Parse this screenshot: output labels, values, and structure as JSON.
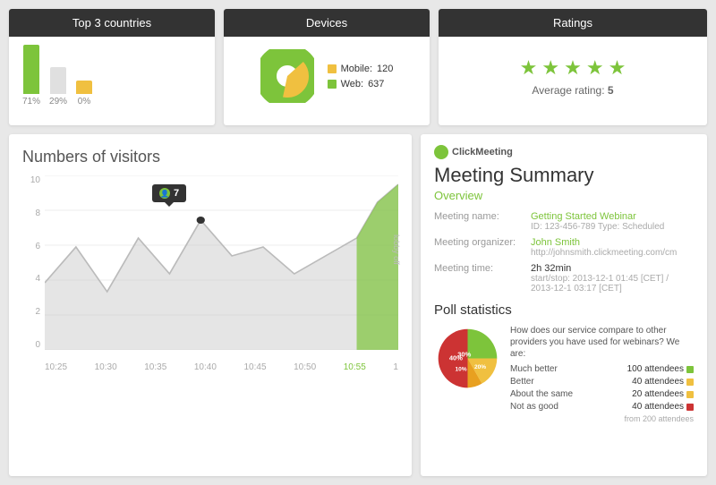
{
  "topCards": {
    "countries": {
      "title": "Top 3 countries",
      "bars": [
        {
          "color": "#7dc43b",
          "height": 55,
          "label": "71%"
        },
        {
          "color": "#e0e0e0",
          "height": 30,
          "label": "29%"
        },
        {
          "color": "#f0c040",
          "height": 15,
          "label": "0%"
        }
      ]
    },
    "devices": {
      "title": "Devices",
      "mobile": {
        "label": "Mobile",
        "value": "120",
        "color": "#f0c040"
      },
      "web": {
        "label": "Web",
        "value": "637",
        "color": "#7dc43b"
      }
    },
    "ratings": {
      "title": "Ratings",
      "starCount": 5,
      "avgLabel": "Average rating:",
      "avgValue": "5"
    }
  },
  "visitorsChart": {
    "title": "Numbers of visitors",
    "yLabels": [
      "0",
      "2",
      "4",
      "6",
      "8",
      "10"
    ],
    "xLabels": [
      "10:25",
      "10:30",
      "10:35",
      "10:40",
      "10:45",
      "10:50",
      "10:55",
      "1"
    ],
    "activeXLabel": "10:55",
    "tooltip": {
      "icon": "👤",
      "value": "7"
    },
    "lobbyLabel": "lobby off"
  },
  "meetingSummary": {
    "logoText": "ClickMeeting",
    "title": "Meeting Summary",
    "sectionTitle": "Overview",
    "fields": [
      {
        "label": "Meeting name:",
        "value": "Getting Started Webinar",
        "subValue": "ID: 123-456-789  Type: Scheduled",
        "valueClass": "green"
      },
      {
        "label": "Meeting organizer:",
        "value": "John Smith",
        "subValue": "http://johnsmith.clickmeeting.com/cm",
        "valueClass": "green"
      },
      {
        "label": "Meeting time:",
        "value": "2h 32min",
        "subValue": "start/stop: 2013-12-1 01:45 [CET] / 2013-12-1 03:17 [CET]",
        "valueClass": ""
      }
    ],
    "pollSection": {
      "title": "Poll statistics",
      "question": "How does our service compare to other providers you have used for webinars? We are:",
      "items": [
        {
          "label": "Much better",
          "value": "100 attendees",
          "color": "#7dc43b",
          "percent": 30
        },
        {
          "label": "Better",
          "value": "40 attendees",
          "color": "#f0c040",
          "percent": 20
        },
        {
          "label": "About the same",
          "value": "20 attendees",
          "color": "#f0c040",
          "percent": 10
        },
        {
          "label": "Not as good",
          "value": "40 attendees",
          "color": "#cc3333",
          "percent": 40
        }
      ],
      "total": "from 200 attendees",
      "pieSlices": [
        {
          "percent": 30,
          "color": "#7dc43b",
          "startAngle": 0
        },
        {
          "percent": 20,
          "color": "#f0c040",
          "startAngle": 108
        },
        {
          "percent": 10,
          "color": "#e8a020",
          "startAngle": 180
        },
        {
          "percent": 40,
          "color": "#cc3333",
          "startAngle": 216
        }
      ]
    }
  }
}
